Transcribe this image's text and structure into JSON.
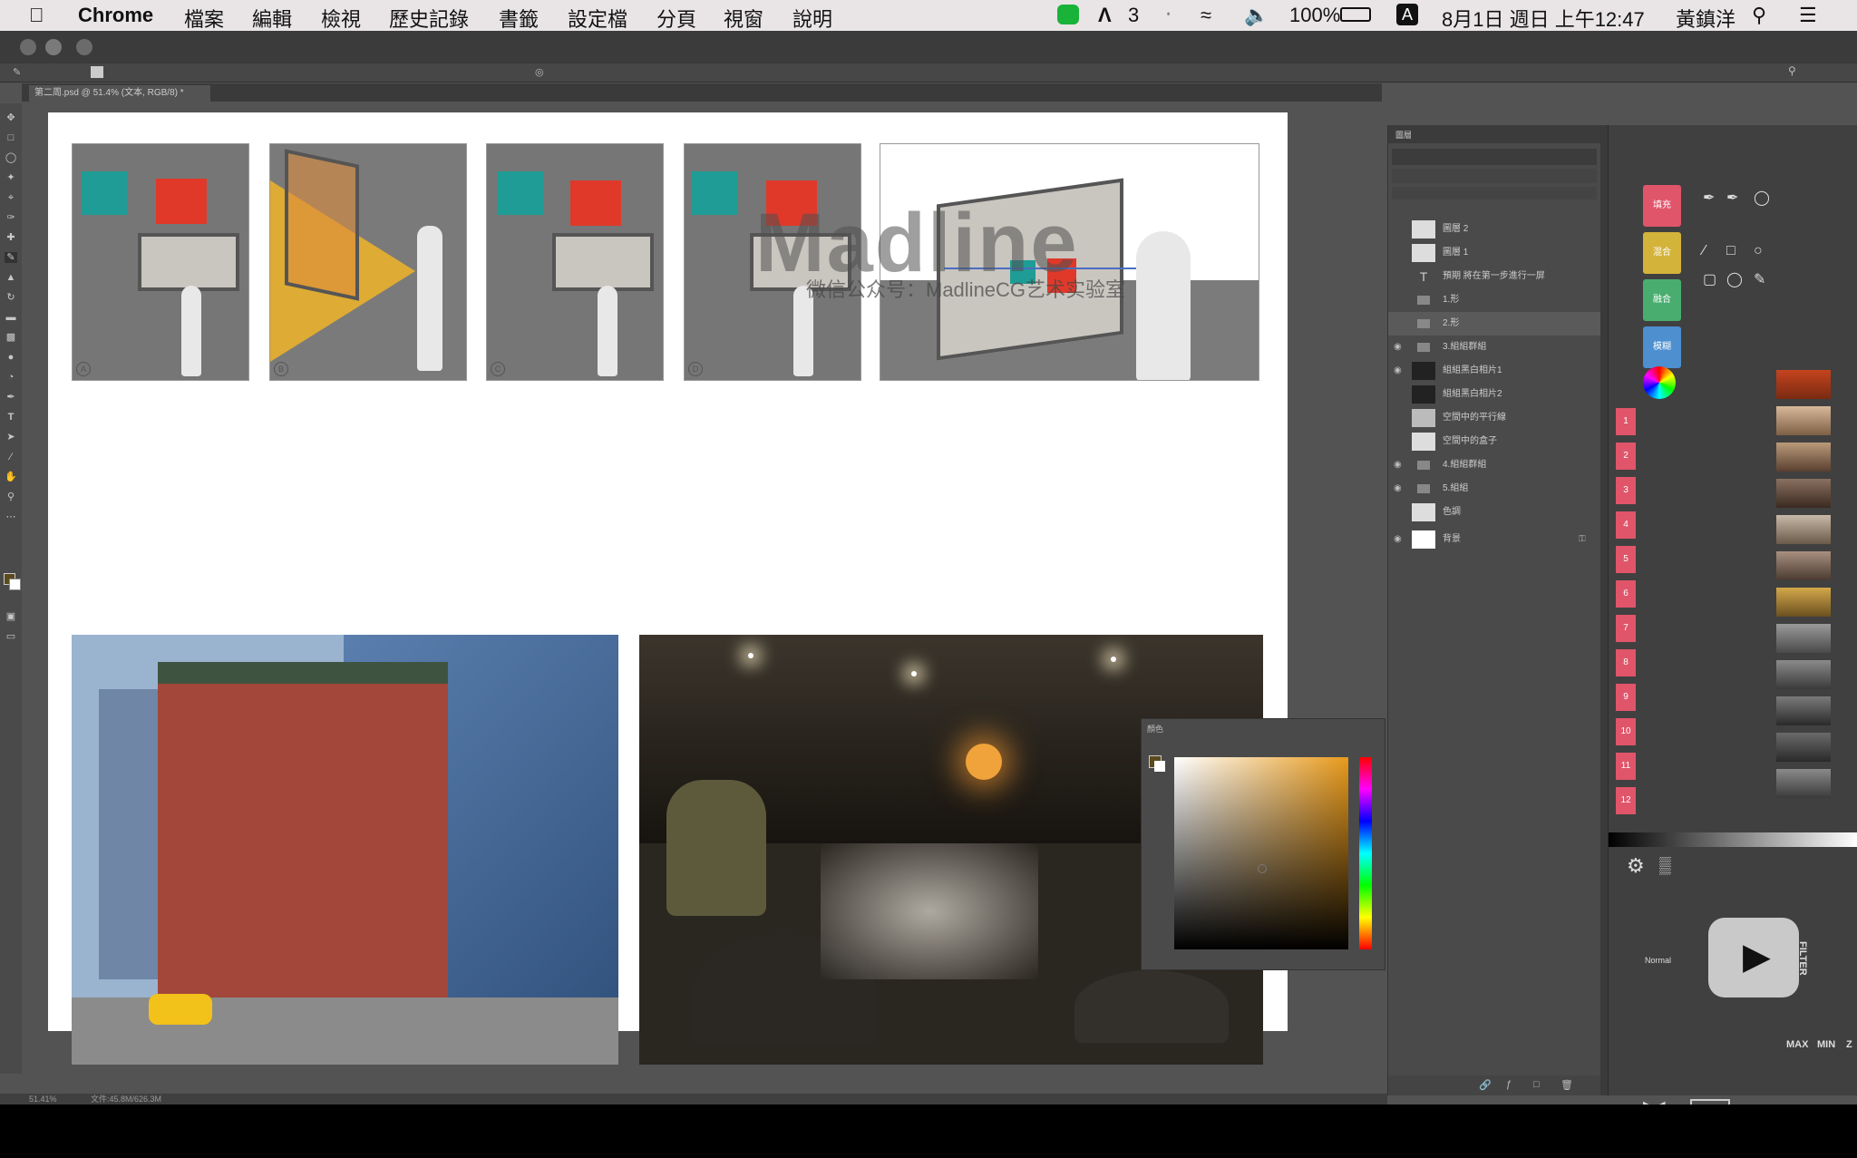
{
  "menubar": {
    "app": "Chrome",
    "items": [
      "檔案",
      "編輯",
      "檢視",
      "歷史記錄",
      "書籤",
      "設定檔",
      "分頁",
      "視窗",
      "說明"
    ],
    "status": {
      "adobe_count": "3",
      "battery": "100%",
      "input_method": "A",
      "datetime": "8月1日 週日 上午12:47",
      "user": "黃鎮洋"
    }
  },
  "document": {
    "tab_title": "第二周.psd @ 51.4% (文本, RGB/8) *",
    "watermark": "Madline",
    "watermark_sub": "微信公众号：MadlineCG艺术实验室",
    "thumb_marks": [
      "A",
      "B",
      "C",
      "D"
    ]
  },
  "layers_panel": {
    "tab": "圖層",
    "rows": [
      {
        "name": "圖層 2",
        "visible": false
      },
      {
        "name": "圖層 1",
        "visible": false
      },
      {
        "name": "預期 將在第一步進行一屏",
        "visible": false
      },
      {
        "name": "1.形",
        "visible": false
      },
      {
        "name": "2.形",
        "visible": false
      },
      {
        "name": "3.組組群組",
        "visible": true
      },
      {
        "name": "組組黑白相片1",
        "visible": true
      },
      {
        "name": "組組黑白相片2",
        "visible": false
      },
      {
        "name": "空間中的平行線",
        "visible": false
      },
      {
        "name": "空間中的盒子",
        "visible": false
      },
      {
        "name": "4.組組群組",
        "visible": true
      },
      {
        "name": "5.組組",
        "visible": true
      },
      {
        "name": "色調",
        "visible": false
      },
      {
        "name": "背景",
        "visible": true
      }
    ]
  },
  "colorpicker": {
    "title": "顏色",
    "selected_hue": "#e89a1c"
  },
  "swatches": {
    "top_buttons": [
      {
        "label": "填充",
        "color": "#e0556a"
      },
      {
        "label": "混合",
        "color": "#d4b33a"
      },
      {
        "label": "融合",
        "color": "#49ad6f"
      },
      {
        "label": "模糊",
        "color": "#4d8fcf"
      }
    ],
    "numbered": [
      "1",
      "2",
      "3",
      "4",
      "5",
      "6",
      "7",
      "8",
      "9",
      "10",
      "11",
      "12"
    ],
    "blend_labels": [
      "Normal",
      "FILTER",
      "MAX",
      "MIN",
      "Z"
    ]
  },
  "statusbar": {
    "zoom": "51.41%",
    "doc": "文件:45.8M/626.3M"
  }
}
